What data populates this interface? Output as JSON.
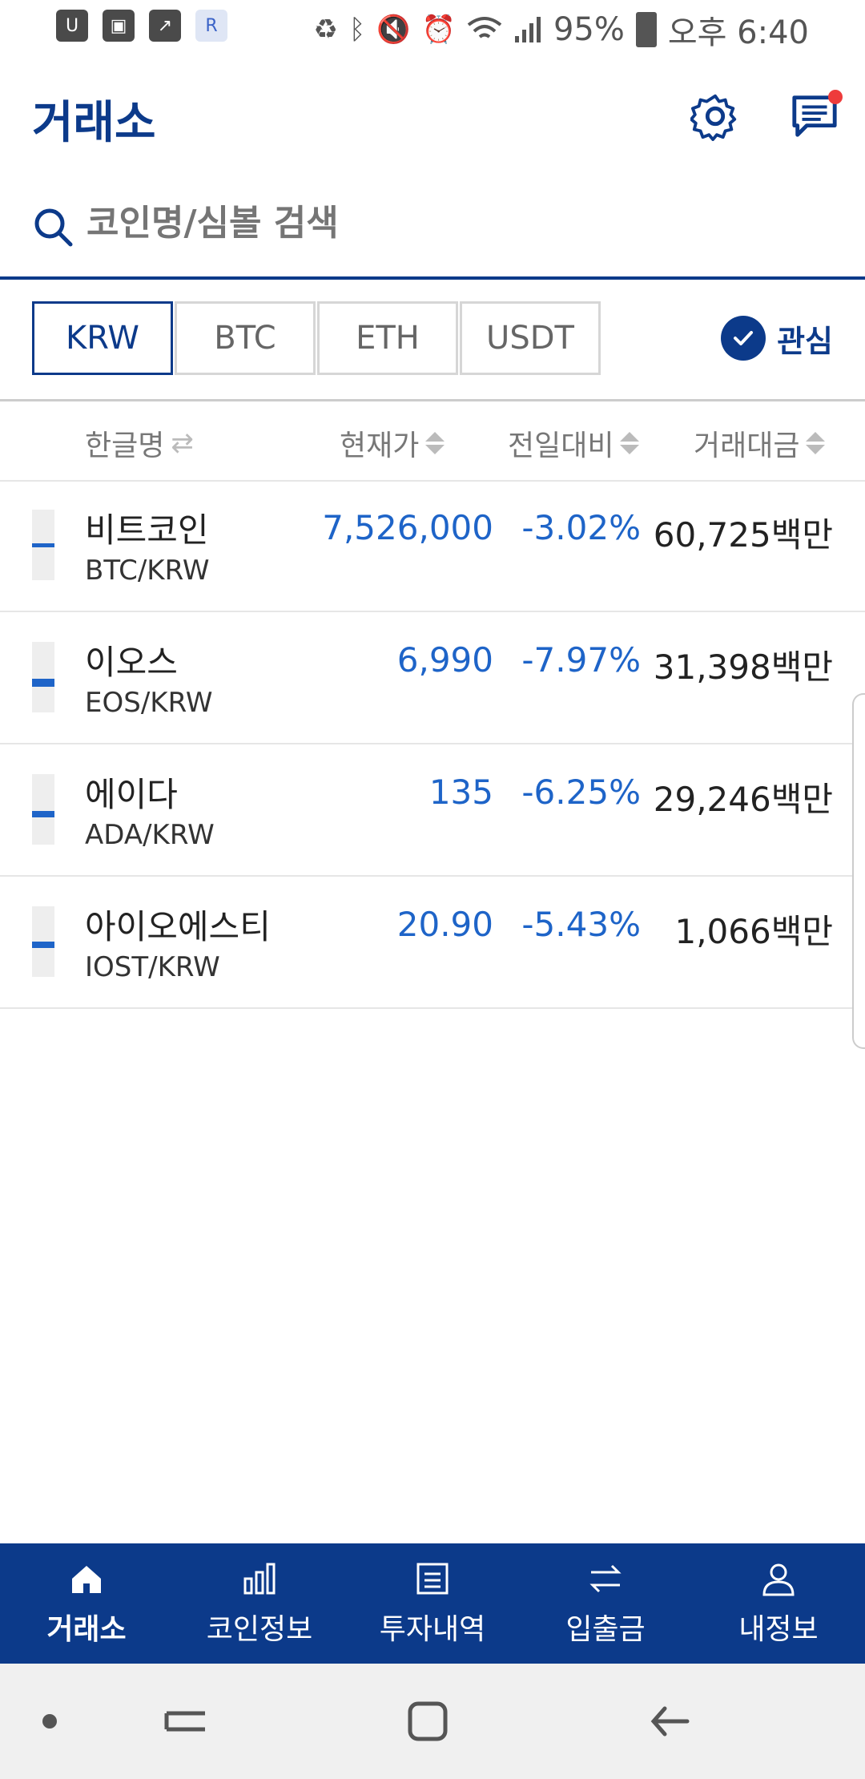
{
  "status_bar": {
    "battery": "95%",
    "time": "오후 6:40",
    "left_icons": [
      "usim-app-icon",
      "gallery-icon",
      "stock-chart-icon",
      "app-r-icon"
    ],
    "right_icons": [
      "recycle-icon",
      "bluetooth-icon",
      "mute-icon",
      "alarm-icon",
      "wifi-icon",
      "signal-icon",
      "battery-icon"
    ]
  },
  "header": {
    "title": "거래소",
    "has_notification": true
  },
  "search": {
    "placeholder": "코인명/심볼 검색"
  },
  "market_tabs": [
    "KRW",
    "BTC",
    "ETH",
    "USDT"
  ],
  "active_tab": "KRW",
  "favorites_label": "관심",
  "table": {
    "headers": {
      "name": "한글명",
      "price": "현재가",
      "change": "전일대비",
      "volume": "거래대금"
    },
    "rows": [
      {
        "name": "비트코인",
        "pair": "BTC/KRW",
        "price": "7,526,000",
        "change": "-3.02%",
        "volume": "60,725백만"
      },
      {
        "name": "이오스",
        "pair": "EOS/KRW",
        "price": "6,990",
        "change": "-7.97%",
        "volume": "31,398백만"
      },
      {
        "name": "에이다",
        "pair": "ADA/KRW",
        "price": "135",
        "change": "-6.25%",
        "volume": "29,246백만"
      },
      {
        "name": "아이오에스티",
        "pair": "IOST/KRW",
        "price": "20.90",
        "change": "-5.43%",
        "volume": "1,066백만"
      }
    ]
  },
  "bottom_nav": {
    "items": [
      {
        "label": "거래소",
        "icon": "home-icon"
      },
      {
        "label": "코인정보",
        "icon": "bar-chart-icon"
      },
      {
        "label": "투자내역",
        "icon": "document-icon"
      },
      {
        "label": "입출금",
        "icon": "transfer-icon"
      },
      {
        "label": "내정보",
        "icon": "person-icon"
      }
    ],
    "active": "거래소"
  },
  "colors": {
    "brand": "#0c3a8a",
    "price_down": "#1e64c8",
    "notification": "#ee3b3b"
  }
}
